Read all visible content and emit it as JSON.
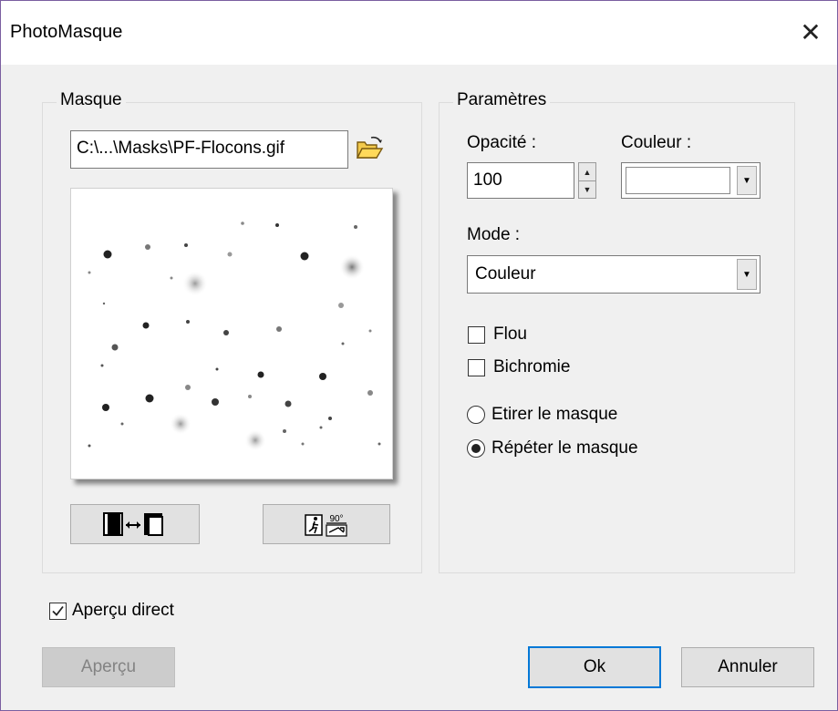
{
  "window": {
    "title": "PhotoMasque",
    "close_symbol": "✕"
  },
  "masque": {
    "legend": "Masque",
    "file_path": "C:\\...\\Masks\\PF-Flocons.gif",
    "browse_icon": "folder-open-icon",
    "invert_button_icon": "invert-mask-icon",
    "rotate_button_icon": "rotate-90-icon",
    "rotate_label": "90°"
  },
  "parametres": {
    "legend": "Paramètres",
    "opacite_label": "Opacité :",
    "opacite_value": "100",
    "couleur_label": "Couleur :",
    "couleur_value": "#ffffff",
    "mode_label": "Mode :",
    "mode_value": "Couleur",
    "flou_label": "Flou",
    "flou_checked": false,
    "bichromie_label": "Bichromie",
    "bichromie_checked": false,
    "etirer_label": "Etirer le masque",
    "etirer_selected": false,
    "repeter_label": "Répéter le masque",
    "repeter_selected": true
  },
  "apercu_direct": {
    "label": "Aperçu direct",
    "checked": true
  },
  "buttons": {
    "apercu": "Aperçu",
    "ok": "Ok",
    "annuler": "Annuler"
  }
}
